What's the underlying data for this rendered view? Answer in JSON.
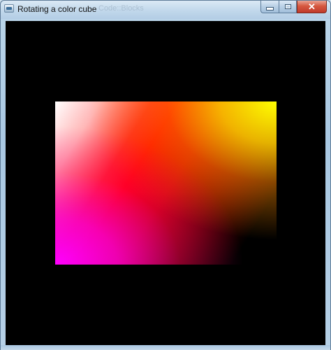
{
  "window": {
    "title": "Rotating a color cube",
    "background_title_ghost": "Code::Blocks",
    "caption_buttons": {
      "minimize_icon": "minimize-icon",
      "maximize_icon": "maximize-icon",
      "close_icon": "close-icon",
      "close_glyph": "✕"
    }
  },
  "canvas": {
    "background_color": "#000000",
    "object": "color-cube-face",
    "corner_colors": {
      "top_left": "#ffffff",
      "top_right": "#ffff00",
      "bottom_left": "#ff00ff",
      "bottom_right": "#000000",
      "center": "#ff0000"
    }
  }
}
